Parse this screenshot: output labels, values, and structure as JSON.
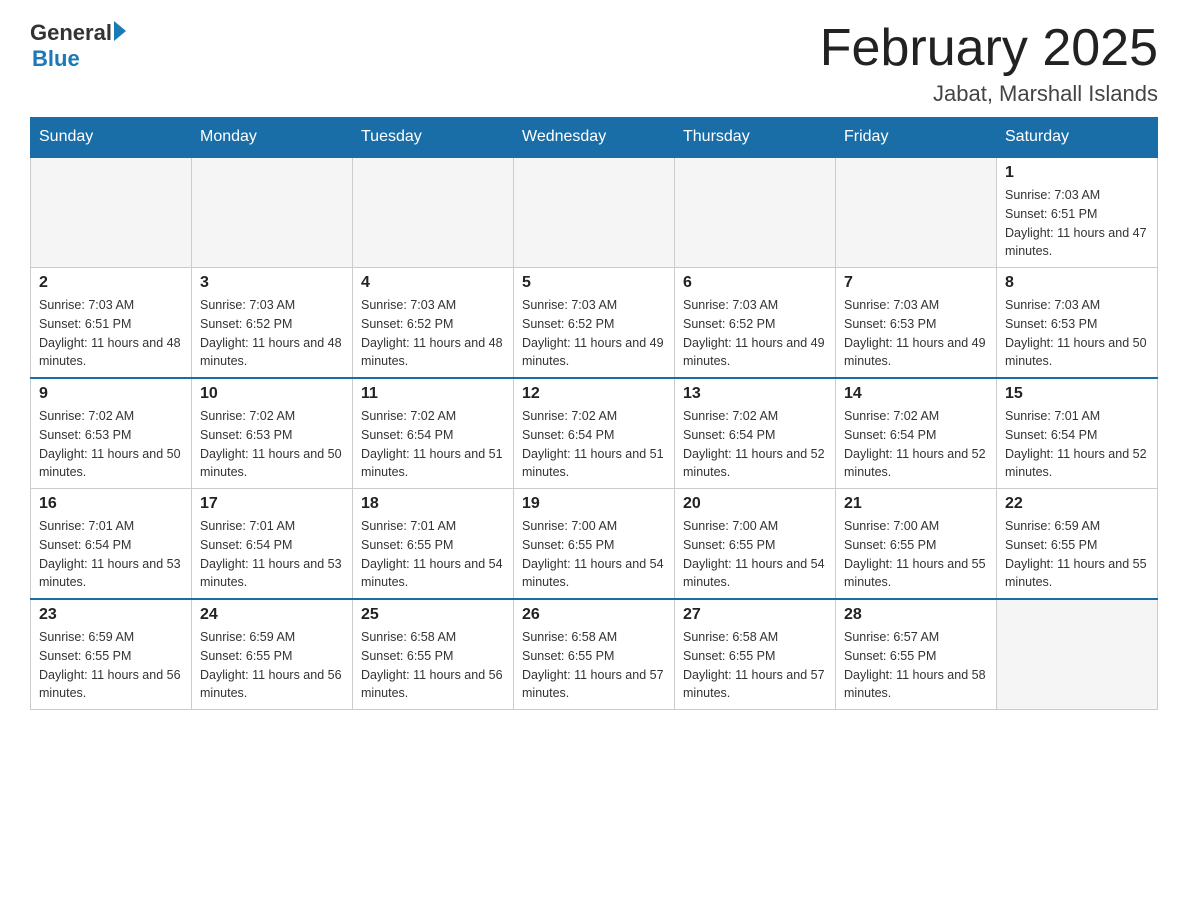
{
  "header": {
    "logo_general": "General",
    "logo_blue": "Blue",
    "month_title": "February 2025",
    "location": "Jabat, Marshall Islands"
  },
  "days_of_week": [
    "Sunday",
    "Monday",
    "Tuesday",
    "Wednesday",
    "Thursday",
    "Friday",
    "Saturday"
  ],
  "weeks": [
    [
      {
        "day": "",
        "empty": true
      },
      {
        "day": "",
        "empty": true
      },
      {
        "day": "",
        "empty": true
      },
      {
        "day": "",
        "empty": true
      },
      {
        "day": "",
        "empty": true
      },
      {
        "day": "",
        "empty": true
      },
      {
        "day": "1",
        "sunrise": "Sunrise: 7:03 AM",
        "sunset": "Sunset: 6:51 PM",
        "daylight": "Daylight: 11 hours and 47 minutes."
      }
    ],
    [
      {
        "day": "2",
        "sunrise": "Sunrise: 7:03 AM",
        "sunset": "Sunset: 6:51 PM",
        "daylight": "Daylight: 11 hours and 48 minutes."
      },
      {
        "day": "3",
        "sunrise": "Sunrise: 7:03 AM",
        "sunset": "Sunset: 6:52 PM",
        "daylight": "Daylight: 11 hours and 48 minutes."
      },
      {
        "day": "4",
        "sunrise": "Sunrise: 7:03 AM",
        "sunset": "Sunset: 6:52 PM",
        "daylight": "Daylight: 11 hours and 48 minutes."
      },
      {
        "day": "5",
        "sunrise": "Sunrise: 7:03 AM",
        "sunset": "Sunset: 6:52 PM",
        "daylight": "Daylight: 11 hours and 49 minutes."
      },
      {
        "day": "6",
        "sunrise": "Sunrise: 7:03 AM",
        "sunset": "Sunset: 6:52 PM",
        "daylight": "Daylight: 11 hours and 49 minutes."
      },
      {
        "day": "7",
        "sunrise": "Sunrise: 7:03 AM",
        "sunset": "Sunset: 6:53 PM",
        "daylight": "Daylight: 11 hours and 49 minutes."
      },
      {
        "day": "8",
        "sunrise": "Sunrise: 7:03 AM",
        "sunset": "Sunset: 6:53 PM",
        "daylight": "Daylight: 11 hours and 50 minutes."
      }
    ],
    [
      {
        "day": "9",
        "sunrise": "Sunrise: 7:02 AM",
        "sunset": "Sunset: 6:53 PM",
        "daylight": "Daylight: 11 hours and 50 minutes."
      },
      {
        "day": "10",
        "sunrise": "Sunrise: 7:02 AM",
        "sunset": "Sunset: 6:53 PM",
        "daylight": "Daylight: 11 hours and 50 minutes."
      },
      {
        "day": "11",
        "sunrise": "Sunrise: 7:02 AM",
        "sunset": "Sunset: 6:54 PM",
        "daylight": "Daylight: 11 hours and 51 minutes."
      },
      {
        "day": "12",
        "sunrise": "Sunrise: 7:02 AM",
        "sunset": "Sunset: 6:54 PM",
        "daylight": "Daylight: 11 hours and 51 minutes."
      },
      {
        "day": "13",
        "sunrise": "Sunrise: 7:02 AM",
        "sunset": "Sunset: 6:54 PM",
        "daylight": "Daylight: 11 hours and 52 minutes."
      },
      {
        "day": "14",
        "sunrise": "Sunrise: 7:02 AM",
        "sunset": "Sunset: 6:54 PM",
        "daylight": "Daylight: 11 hours and 52 minutes."
      },
      {
        "day": "15",
        "sunrise": "Sunrise: 7:01 AM",
        "sunset": "Sunset: 6:54 PM",
        "daylight": "Daylight: 11 hours and 52 minutes."
      }
    ],
    [
      {
        "day": "16",
        "sunrise": "Sunrise: 7:01 AM",
        "sunset": "Sunset: 6:54 PM",
        "daylight": "Daylight: 11 hours and 53 minutes."
      },
      {
        "day": "17",
        "sunrise": "Sunrise: 7:01 AM",
        "sunset": "Sunset: 6:54 PM",
        "daylight": "Daylight: 11 hours and 53 minutes."
      },
      {
        "day": "18",
        "sunrise": "Sunrise: 7:01 AM",
        "sunset": "Sunset: 6:55 PM",
        "daylight": "Daylight: 11 hours and 54 minutes."
      },
      {
        "day": "19",
        "sunrise": "Sunrise: 7:00 AM",
        "sunset": "Sunset: 6:55 PM",
        "daylight": "Daylight: 11 hours and 54 minutes."
      },
      {
        "day": "20",
        "sunrise": "Sunrise: 7:00 AM",
        "sunset": "Sunset: 6:55 PM",
        "daylight": "Daylight: 11 hours and 54 minutes."
      },
      {
        "day": "21",
        "sunrise": "Sunrise: 7:00 AM",
        "sunset": "Sunset: 6:55 PM",
        "daylight": "Daylight: 11 hours and 55 minutes."
      },
      {
        "day": "22",
        "sunrise": "Sunrise: 6:59 AM",
        "sunset": "Sunset: 6:55 PM",
        "daylight": "Daylight: 11 hours and 55 minutes."
      }
    ],
    [
      {
        "day": "23",
        "sunrise": "Sunrise: 6:59 AM",
        "sunset": "Sunset: 6:55 PM",
        "daylight": "Daylight: 11 hours and 56 minutes."
      },
      {
        "day": "24",
        "sunrise": "Sunrise: 6:59 AM",
        "sunset": "Sunset: 6:55 PM",
        "daylight": "Daylight: 11 hours and 56 minutes."
      },
      {
        "day": "25",
        "sunrise": "Sunrise: 6:58 AM",
        "sunset": "Sunset: 6:55 PM",
        "daylight": "Daylight: 11 hours and 56 minutes."
      },
      {
        "day": "26",
        "sunrise": "Sunrise: 6:58 AM",
        "sunset": "Sunset: 6:55 PM",
        "daylight": "Daylight: 11 hours and 57 minutes."
      },
      {
        "day": "27",
        "sunrise": "Sunrise: 6:58 AM",
        "sunset": "Sunset: 6:55 PM",
        "daylight": "Daylight: 11 hours and 57 minutes."
      },
      {
        "day": "28",
        "sunrise": "Sunrise: 6:57 AM",
        "sunset": "Sunset: 6:55 PM",
        "daylight": "Daylight: 11 hours and 58 minutes."
      },
      {
        "day": "",
        "empty": true
      }
    ]
  ]
}
